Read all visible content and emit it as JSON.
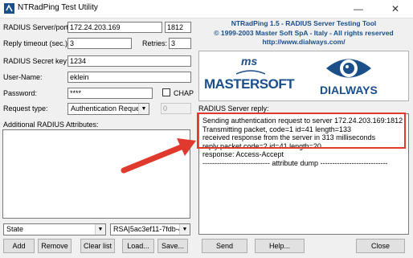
{
  "window": {
    "title": "NTRadPing Test Utility",
    "minimize": "—",
    "close": "✕"
  },
  "form": {
    "server_label": "RADIUS Server/port:",
    "server_value": "172.24.203.169",
    "port_value": "1812",
    "timeout_label": "Reply timeout (sec.):",
    "timeout_value": "3",
    "retries_label": "Retries:",
    "retries_value": "3",
    "secret_label": "RADIUS Secret key:",
    "secret_value": "1234",
    "username_label": "User-Name:",
    "username_value": "eklein",
    "password_label": "Password:",
    "password_value": "****",
    "chap_label": "CHAP",
    "request_type_label": "Request type:",
    "request_type_value": "Authentication Request",
    "request_num_value": "0",
    "attributes_label": "Additional RADIUS Attributes:",
    "attr_name_value": "State",
    "attr_value_value": "RSA|5ac3ef11-7fdb-4e"
  },
  "buttons": {
    "add": "Add",
    "remove": "Remove",
    "clear": "Clear list",
    "load": "Load...",
    "save": "Save...",
    "send": "Send",
    "help": "Help...",
    "close": "Close"
  },
  "banner": {
    "line1": "NTRadPing 1.5 - RADIUS Server Testing Tool",
    "line2": "© 1999-2003 Master Soft SpA - Italy - All rights reserved",
    "line3": "http://www.dialways.com/",
    "mastersoft_logo": "MASTERSOFT",
    "ms_mark": "ms",
    "dialways_logo": "DIALWAYS"
  },
  "reply": {
    "label": "RADIUS Server reply:",
    "lines": [
      "Sending authentication request to server 172.24.203.169:1812",
      "Transmitting packet, code=1 id=41 length=133",
      "received response from the server in 313 milliseconds",
      "reply packet code=2 id=41 length=20",
      "response: Access-Accept",
      "---------------------------- attribute dump ----------------------------"
    ]
  },
  "colors": {
    "highlight_box": "#e03a2f",
    "arrow": "#e03a2f",
    "brand_blue": "#1a4f8a"
  }
}
